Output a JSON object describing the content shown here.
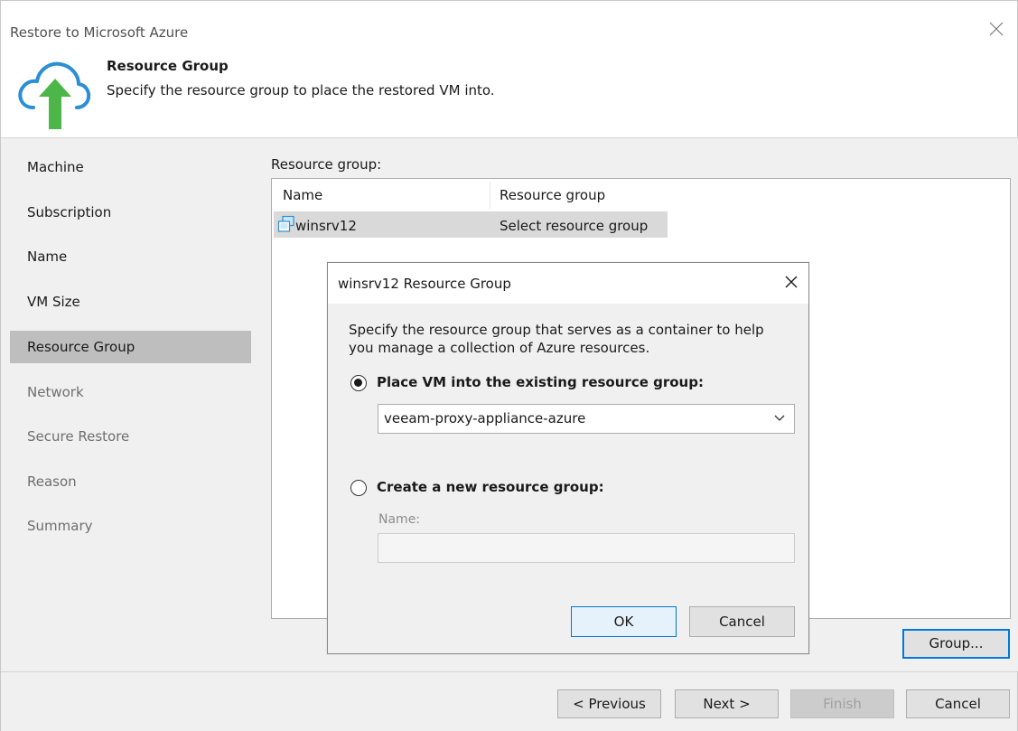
{
  "window": {
    "title": "Restore to Microsoft Azure"
  },
  "header": {
    "title": "Resource Group",
    "description": "Specify the resource group to place the restored VM into."
  },
  "sidebar": {
    "items": [
      {
        "label": "Machine"
      },
      {
        "label": "Subscription"
      },
      {
        "label": "Name"
      },
      {
        "label": "VM Size"
      },
      {
        "label": "Resource Group"
      },
      {
        "label": "Network"
      },
      {
        "label": "Secure Restore"
      },
      {
        "label": "Reason"
      },
      {
        "label": "Summary"
      }
    ],
    "active_index": 4
  },
  "main": {
    "section_label": "Resource group:",
    "table": {
      "columns": [
        "Name",
        "Resource group"
      ],
      "rows": [
        {
          "name": "winsrv12",
          "resource_group": "Select resource group"
        }
      ]
    },
    "group_button": "Group..."
  },
  "footer": {
    "previous": "< Previous",
    "next": "Next >",
    "finish": "Finish",
    "cancel": "Cancel"
  },
  "dialog": {
    "title": "winsrv12 Resource Group",
    "description": "Specify the resource group that serves as a container to help you manage a collection of Azure resources.",
    "option_existing": {
      "label": "Place VM into the existing resource group:",
      "selected": true,
      "value": "veeam-proxy-appliance-azure"
    },
    "option_new": {
      "label": "Create a new resource group:",
      "selected": false,
      "name_label": "Name:",
      "name_value": ""
    },
    "ok": "OK",
    "cancel": "Cancel"
  },
  "colors": {
    "accent": "#0078d7",
    "sidebar_bg": "#f0f0f0",
    "active_item_bg": "#bebebe",
    "cloud_blue": "#2b8fd6",
    "arrow_green": "#4cb748"
  },
  "icons": {
    "header": "cloud-upload-icon",
    "vm": "virtual-machine-icon",
    "close": "close-icon",
    "dropdown": "chevron-down-icon"
  }
}
